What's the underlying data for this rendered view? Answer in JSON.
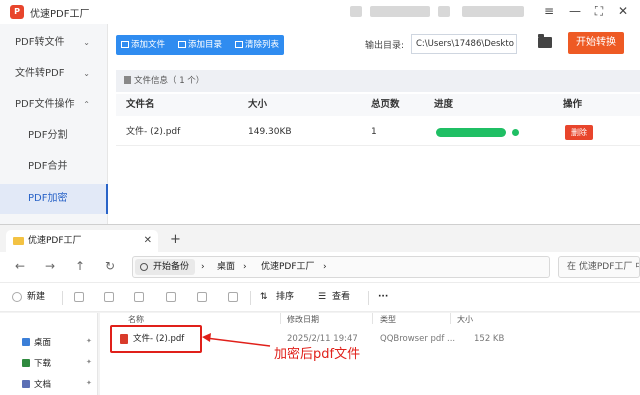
{
  "app": {
    "title": "优速PDF工厂",
    "window_controls": [
      "≡",
      "—",
      "⛶",
      "✕"
    ]
  },
  "sidebar": {
    "items": [
      {
        "label": "PDF转文件",
        "chevron": "⌄"
      },
      {
        "label": "文件转PDF",
        "chevron": "⌄"
      },
      {
        "label": "PDF文件操作",
        "chevron": "⌃"
      },
      {
        "label": "PDF分割"
      },
      {
        "label": "PDF合并"
      },
      {
        "label": "PDF加密"
      }
    ]
  },
  "toolbar": {
    "add_file": "添加文件",
    "add_folder": "添加目录",
    "clear_list": "清除列表",
    "output_label": "输出目录:",
    "output_path": "C:\\Users\\17486\\Deskto",
    "start_button": "开始转换"
  },
  "file_info": {
    "label": "文件信息（ 1 个）"
  },
  "table": {
    "headers": [
      "文件名",
      "大小",
      "总页数",
      "进度",
      "操作"
    ],
    "rows": [
      {
        "name": "文件- (2).pdf",
        "size": "149.30KB",
        "pages": "1",
        "progress": 1.0,
        "action": "删除"
      }
    ]
  },
  "explorer": {
    "tab_title": "优速PDF工厂",
    "tab_close": "✕",
    "new_tab": "+",
    "nav": {
      "back": "←",
      "forward": "→",
      "up": "↑",
      "refresh": "↻"
    },
    "address": {
      "backup": "开始备份",
      "sep": "›",
      "seg1": "桌面",
      "seg2": "优速PDF工厂",
      "seg3": "›"
    },
    "search_placeholder": "在 优速PDF工厂 中",
    "commands": {
      "new": "新建",
      "sort": "排序",
      "view": "查看",
      "more": "···"
    },
    "nav_pane": [
      {
        "label": "桌面",
        "color": "#3b7fd8"
      },
      {
        "label": "下载",
        "color": "#2f8a3e"
      },
      {
        "label": "文档",
        "color": "#5b6fb5"
      }
    ],
    "columns": [
      "名称",
      "修改日期",
      "类型",
      "大小"
    ],
    "files": [
      {
        "name": "文件- (2).pdf",
        "modified": "2025/2/11 19:47",
        "type": "QQBrowser pdf ...",
        "size": "152 KB"
      }
    ],
    "annotation": "加密后pdf文件"
  },
  "colors": {
    "accent_blue": "#2f8cf0",
    "start_orange": "#ee5a24",
    "progress_green": "#1fbf64",
    "delete_red": "#e8452c",
    "annotation_red": "#e0201a"
  }
}
